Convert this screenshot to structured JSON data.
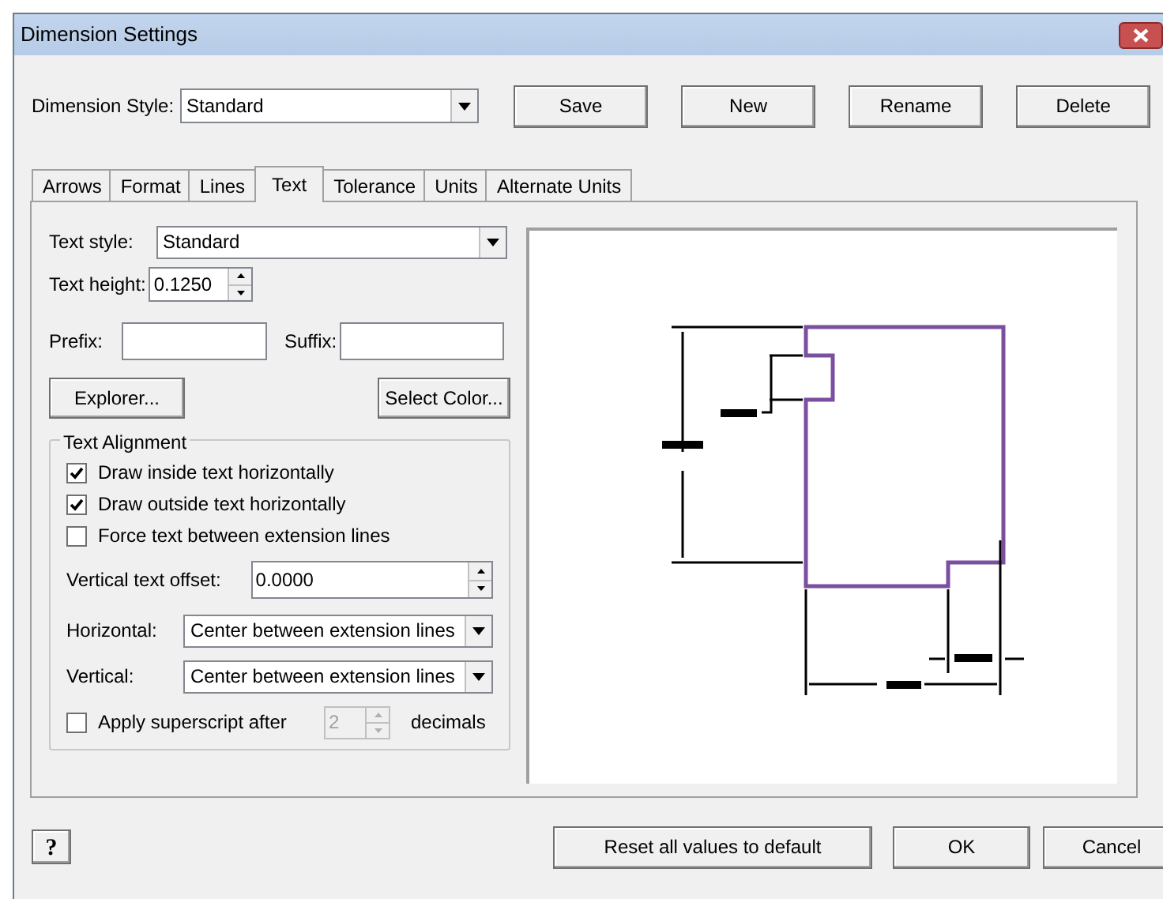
{
  "window": {
    "title": "Dimension Settings"
  },
  "dimension_style": {
    "label": "Dimension Style:",
    "value": "Standard"
  },
  "style_buttons": [
    "Save",
    "New",
    "Rename",
    "Delete"
  ],
  "tabs": [
    {
      "label": "Arrows",
      "selected": false
    },
    {
      "label": "Format",
      "selected": false
    },
    {
      "label": "Lines",
      "selected": false
    },
    {
      "label": "Text",
      "selected": true
    },
    {
      "label": "Tolerance",
      "selected": false
    },
    {
      "label": "Units",
      "selected": false
    },
    {
      "label": "Alternate Units",
      "selected": false
    }
  ],
  "text_style": {
    "label": "Text style:",
    "value": "Standard"
  },
  "text_height": {
    "label": "Text height:",
    "value": "0.1250"
  },
  "prefix": {
    "label": "Prefix:"
  },
  "suffix": {
    "label": "Suffix:"
  },
  "explorer_button": "Explorer...",
  "select_color_button": "Select Color...",
  "text_alignment": {
    "title": "Text Alignment",
    "options": [
      {
        "label": "Draw inside text horizontally",
        "checked": true
      },
      {
        "label": "Draw outside text horizontally",
        "checked": true
      },
      {
        "label": "Force text between extension lines",
        "checked": false
      }
    ],
    "vertical_offset": {
      "label": "Vertical text offset:",
      "value": "0.0000"
    },
    "horizontal": {
      "label": "Horizontal:",
      "value": "Center between extension lines"
    },
    "vertical": {
      "label": "Vertical:",
      "value": "Center between extension lines"
    },
    "superscript": {
      "label": "Apply superscript after",
      "checked": false,
      "value": "2",
      "disabled": true,
      "unit": "decimals"
    }
  },
  "help_button": "?",
  "footer_buttons": [
    "Reset all values to default",
    "OK",
    "Cancel"
  ]
}
